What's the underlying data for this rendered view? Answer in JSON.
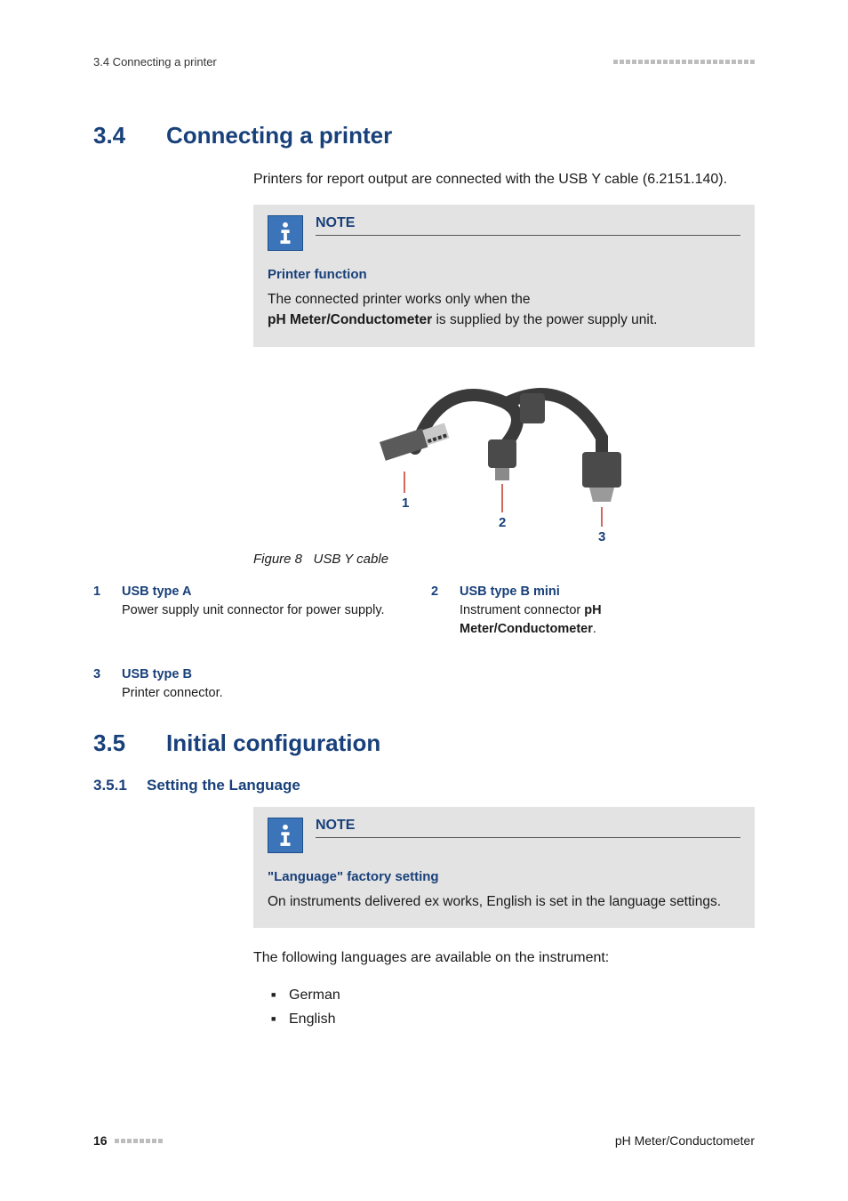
{
  "header": {
    "breadcrumb": "3.4 Connecting a printer"
  },
  "section34": {
    "number": "3.4",
    "title": "Connecting a printer",
    "intro": "Printers for report output are connected with the USB Y cable (6.2151.140).",
    "note": {
      "label": "NOTE",
      "subtitle": "Printer function",
      "line1": "The connected printer works only when the",
      "bold": "pH Meter/Conductometer",
      "line2": " is supplied by the power supply unit."
    },
    "figure": {
      "num": "Figure 8",
      "caption": "USB Y cable",
      "callouts": {
        "c1": "1",
        "c2": "2",
        "c3": "3"
      }
    },
    "legend": [
      {
        "n": "1",
        "title": "USB type A",
        "desc": "Power supply unit connector for power supply."
      },
      {
        "n": "2",
        "title": "USB type B mini",
        "desc_pre": "Instrument connector ",
        "desc_bold": "pH Meter/Conductometer",
        "desc_post": "."
      },
      {
        "n": "3",
        "title": "USB type B",
        "desc": "Printer connector."
      }
    ]
  },
  "section35": {
    "number": "3.5",
    "title": "Initial configuration",
    "sub351": {
      "number": "3.5.1",
      "title": "Setting the Language",
      "note": {
        "label": "NOTE",
        "subtitle": "\"Language\" factory setting",
        "body": "On instruments delivered ex works, English is set in the language settings."
      },
      "avail": "The following languages are available on the instrument:",
      "languages": [
        "German",
        "English"
      ]
    }
  },
  "footer": {
    "page": "16",
    "product": "pH Meter/Conductometer"
  }
}
